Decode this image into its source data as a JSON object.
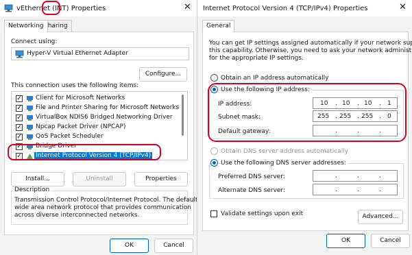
{
  "left_dialog": {
    "title_prefix": "vEthernet ",
    "title_highlight": "(INT)",
    "title_suffix": " Properties",
    "tabs": [
      "Networking",
      "Sharing"
    ],
    "connect_using_label": "Connect using:",
    "adapter_name": "Hyper-V Virtual Ethernet Adapter",
    "configure_button": "Configure...",
    "items_label": "This connection uses the following items:",
    "items": [
      {
        "label": "Client for Microsoft Networks",
        "checked": true
      },
      {
        "label": "File and Printer Sharing for Microsoft Networks",
        "checked": true
      },
      {
        "label": "VirtualBox NDIS6 Bridged Networking Driver",
        "checked": true
      },
      {
        "label": "Npcap Packet Driver (NPCAP)",
        "checked": true
      },
      {
        "label": "QoS Packet Scheduler",
        "checked": true
      },
      {
        "label": "Bridge Driver",
        "checked": true
      },
      {
        "label": "Internet Protocol Version 4 (TCP/IPv4)",
        "checked": true,
        "selected": true
      }
    ],
    "install_button": "Install...",
    "uninstall_button": "Uninstall",
    "properties_button": "Properties",
    "description_label": "Description",
    "description_text": [
      "Transmission Control Protocol/Internet Protocol. The default",
      "wide area network protocol that provides communication",
      "across diverse interconnected networks."
    ],
    "ok_button": "OK",
    "cancel_button": "Cancel",
    "close_glyph": "✕"
  },
  "right_dialog": {
    "title": "Internet Protocol Version 4 (TCP/IPv4) Properties",
    "tab": "General",
    "intro_text": [
      "You can get IP settings assigned automatically if your network supports",
      "this capability. Otherwise, you need to ask your network administrator",
      "for the appropriate IP settings."
    ],
    "obtain_ip_auto": "Obtain an IP address automatically",
    "use_following_ip": "Use the following IP address:",
    "ip_address_label": "IP address:",
    "ip_address": [
      "10",
      "10",
      "10",
      "1"
    ],
    "subnet_mask_label": "Subnet mask:",
    "subnet_mask": [
      "255",
      "255",
      "255",
      "0"
    ],
    "default_gateway_label": "Default gateway:",
    "obtain_dns_auto": "Obtain DNS server address automatically",
    "use_following_dns": "Use the following DNS server addresses:",
    "preferred_dns_label": "Preferred DNS server:",
    "alternate_dns_label": "Alternate DNS server:",
    "validate_label": "Validate settings upon exit",
    "advanced_button": "Advanced...",
    "ok_button": "OK",
    "cancel_button": "Cancel",
    "close_glyph": "✕"
  },
  "colors": {
    "highlight_red": "#d9001b",
    "selection_blue": "#0078d4",
    "accent": "#005fb8"
  }
}
